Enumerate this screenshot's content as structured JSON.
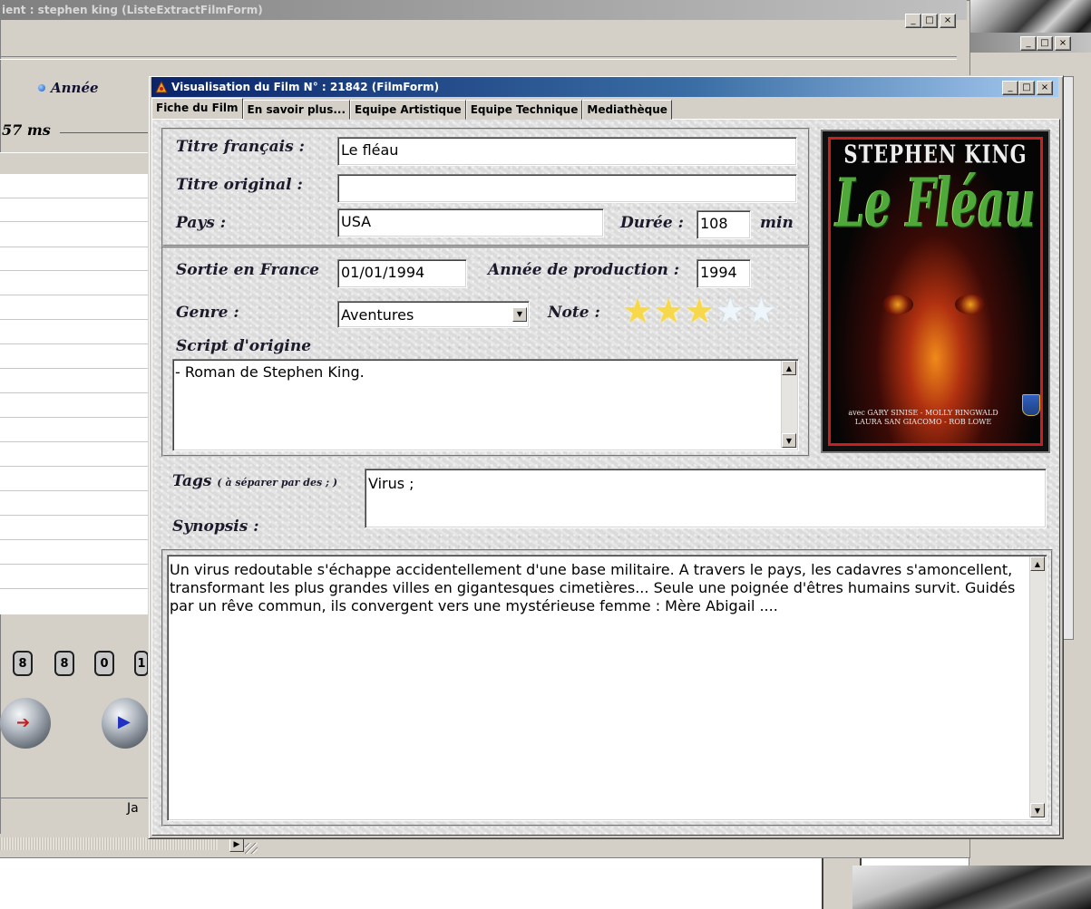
{
  "background_window": {
    "title": "ient : stephen king (ListeExtractFilmForm)",
    "sort_label": "Année",
    "timing_label": "57 ms",
    "footer_text": "Ja",
    "nav_buttons": [
      "8",
      "8",
      "0",
      "1"
    ]
  },
  "window": {
    "title": "Visualisation du Film N° : 21842 (FilmForm)",
    "buttons": {
      "minimize": "_",
      "maximize": "□",
      "close": "×"
    }
  },
  "tabs": [
    {
      "label": "Fiche du Film",
      "active": true
    },
    {
      "label": "En savoir plus...",
      "active": false
    },
    {
      "label": "Equipe Artistique",
      "active": false
    },
    {
      "label": "Equipe Technique",
      "active": false
    },
    {
      "label": "Mediathèque",
      "active": false
    }
  ],
  "form": {
    "titre_francais_label": "Titre français :",
    "titre_francais_value": "Le fléau",
    "titre_original_label": "Titre original :",
    "titre_original_value": "",
    "pays_label": "Pays :",
    "pays_value": "USA",
    "duree_label": "Durée :",
    "duree_value": "108",
    "duree_unit": "min",
    "sortie_label": "Sortie en France",
    "sortie_value": "01/01/1994",
    "annee_production_label": "Année de production :",
    "annee_production_value": "1994",
    "genre_label": "Genre :",
    "genre_value": "Aventures",
    "note_label": "Note :",
    "note_value": 3,
    "note_max": 5,
    "script_label": "Script d'origine",
    "script_value": "- Roman de Stephen King.",
    "tags_label": "Tags",
    "tags_hint": "( à séparer par des ; )",
    "tags_value": "Virus ;",
    "synopsis_label": "Synopsis :",
    "synopsis_value": "Un virus redoutable s'échappe accidentellement d'une base militaire. A travers le pays, les cadavres s'amoncellent, transformant les plus grandes villes en gigantesques cimetières... Seule une poignée d'êtres humains survit. Guidés par un rêve commun, ils convergent vers une mystérieuse femme : Mère Abigail ...."
  },
  "poster": {
    "author": "STEPHEN KING",
    "title": "Le Fléau",
    "cast_line1": "avec GARY SINISE - MOLLY RINGWALD",
    "cast_line2": "LAURA SAN GIACOMO - ROB LOWE"
  },
  "colors": {
    "title_bar_start": "#0a246a",
    "title_bar_end": "#a6caf0",
    "star_on": "#f6d84a",
    "star_off": "#eef6fb",
    "poster_title": "#4fa83a",
    "poster_frame": "#c8201c"
  }
}
